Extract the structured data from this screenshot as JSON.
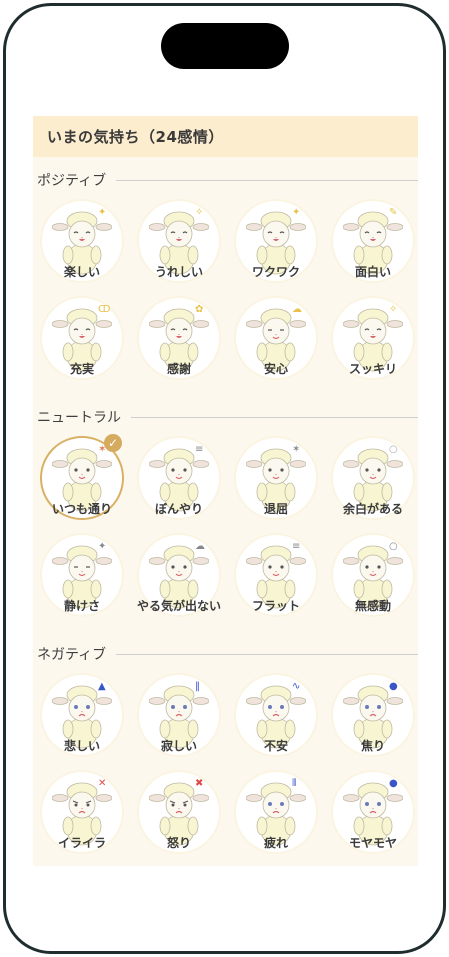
{
  "header": {
    "title": "いまの気持ち（24感情）"
  },
  "sections": [
    {
      "title": "ポジティブ",
      "emotions": [
        {
          "label": "楽しい",
          "mark": "✦",
          "mark_color": "#e8c24a",
          "mood": "happy"
        },
        {
          "label": "うれしい",
          "mark": "✧",
          "mark_color": "#e8c24a",
          "mood": "happy"
        },
        {
          "label": "ワクワク",
          "mark": "✦",
          "mark_color": "#e8c24a",
          "mood": "happy"
        },
        {
          "label": "面白い",
          "mark": "✎",
          "mark_color": "#e8c24a",
          "mood": "happy"
        },
        {
          "label": "充実",
          "mark": "ↀ",
          "mark_color": "#e8c24a",
          "mood": "happy"
        },
        {
          "label": "感謝",
          "mark": "✿",
          "mark_color": "#e8c24a",
          "mood": "happy"
        },
        {
          "label": "安心",
          "mark": "☁",
          "mark_color": "#e8c24a",
          "mood": "calm"
        },
        {
          "label": "スッキリ",
          "mark": "✧",
          "mark_color": "#e8c24a",
          "mood": "happy"
        }
      ]
    },
    {
      "title": "ニュートラル",
      "emotions": [
        {
          "label": "いつも通り",
          "mark": "✶",
          "mark_color": "#e07a52",
          "mood": "neutral",
          "selected": true
        },
        {
          "label": "ぼんやり",
          "mark": "≡",
          "mark_color": "#888888",
          "mood": "neutral"
        },
        {
          "label": "退屈",
          "mark": "✶",
          "mark_color": "#888888",
          "mood": "neutral"
        },
        {
          "label": "余白がある",
          "mark": "○",
          "mark_color": "#aaaaaa",
          "mood": "neutral"
        },
        {
          "label": "静けさ",
          "mark": "✦",
          "mark_color": "#888888",
          "mood": "calm"
        },
        {
          "label": "やる気が出ない",
          "mark": "☁",
          "mark_color": "#888888",
          "mood": "neutral"
        },
        {
          "label": "フラット",
          "mark": "≡",
          "mark_color": "#888888",
          "mood": "neutral"
        },
        {
          "label": "無感動",
          "mark": "○",
          "mark_color": "#888888",
          "mood": "neutral"
        }
      ]
    },
    {
      "title": "ネガティブ",
      "emotions": [
        {
          "label": "悲しい",
          "mark": "▲",
          "mark_color": "#3a55c8",
          "mood": "sad"
        },
        {
          "label": "寂しい",
          "mark": "‖",
          "mark_color": "#3a55c8",
          "mood": "sad"
        },
        {
          "label": "不安",
          "mark": "∿",
          "mark_color": "#3a55c8",
          "mood": "sad"
        },
        {
          "label": "焦り",
          "mark": "●",
          "mark_color": "#3a55c8",
          "mood": "sad"
        },
        {
          "label": "イライラ",
          "mark": "✕",
          "mark_color": "#e04848",
          "mood": "angry"
        },
        {
          "label": "怒り",
          "mark": "✖",
          "mark_color": "#e04848",
          "mood": "angry"
        },
        {
          "label": "疲れ",
          "mark": "⦀",
          "mark_color": "#3a55c8",
          "mood": "sad"
        },
        {
          "label": "モヤモヤ",
          "mark": "●",
          "mark_color": "#3a55c8",
          "mood": "sad"
        }
      ]
    }
  ],
  "colors": {
    "accent": "#d4ab5f",
    "panel_bg": "#fdf8ee",
    "header_bg": "#fdedcf",
    "sheep_wool": "#f8f5d2"
  },
  "icons": {
    "selected_check": "✓"
  }
}
